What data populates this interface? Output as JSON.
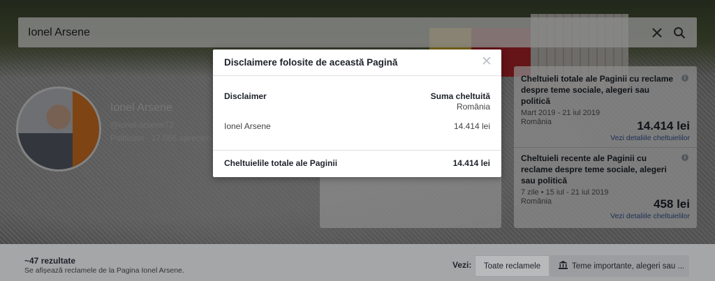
{
  "search": {
    "query": "Ionel Arsene"
  },
  "profile": {
    "name": "Ionel Arsene",
    "handle": "@ionel.arsene72",
    "meta": "Politician · 17.066 aprecieri"
  },
  "spend_cards": [
    {
      "title": "Cheltuieli totale ale Paginii cu reclame despre teme sociale, alegeri sau politică",
      "dates": "Mart 2019 - 21 iul 2019",
      "country": "România",
      "amount": "14.414 lei",
      "link": "Vezi detaliile cheltuielilor"
    },
    {
      "title": "Cheltuieli recente ale Paginii cu reclame despre teme sociale, alegeri sau politică",
      "dates": "7 zile • 15 iul - 21 iul 2019",
      "country": "România",
      "amount": "458 lei",
      "link": "Vezi detaliile cheltuielilor"
    }
  ],
  "bottom": {
    "results": "~47 rezultate",
    "results_sub": "Se afișează reclamele de la Pagina Ionel Arsene.",
    "vezi": "Vezi:",
    "all_ads": "Toate reclamele",
    "themes": "Teme importante, alegeri sau ..."
  },
  "modal": {
    "title": "Disclaimere folosite de această Pagină",
    "col_disclaimer": "Disclaimer",
    "col_amount": "Suma cheltuită",
    "col_amount_sub": "România",
    "row_name": "Ionel Arsene",
    "row_value": "14.414 lei",
    "total_label": "Cheltuielile totale ale Paginii",
    "total_value": "14.414 lei"
  }
}
